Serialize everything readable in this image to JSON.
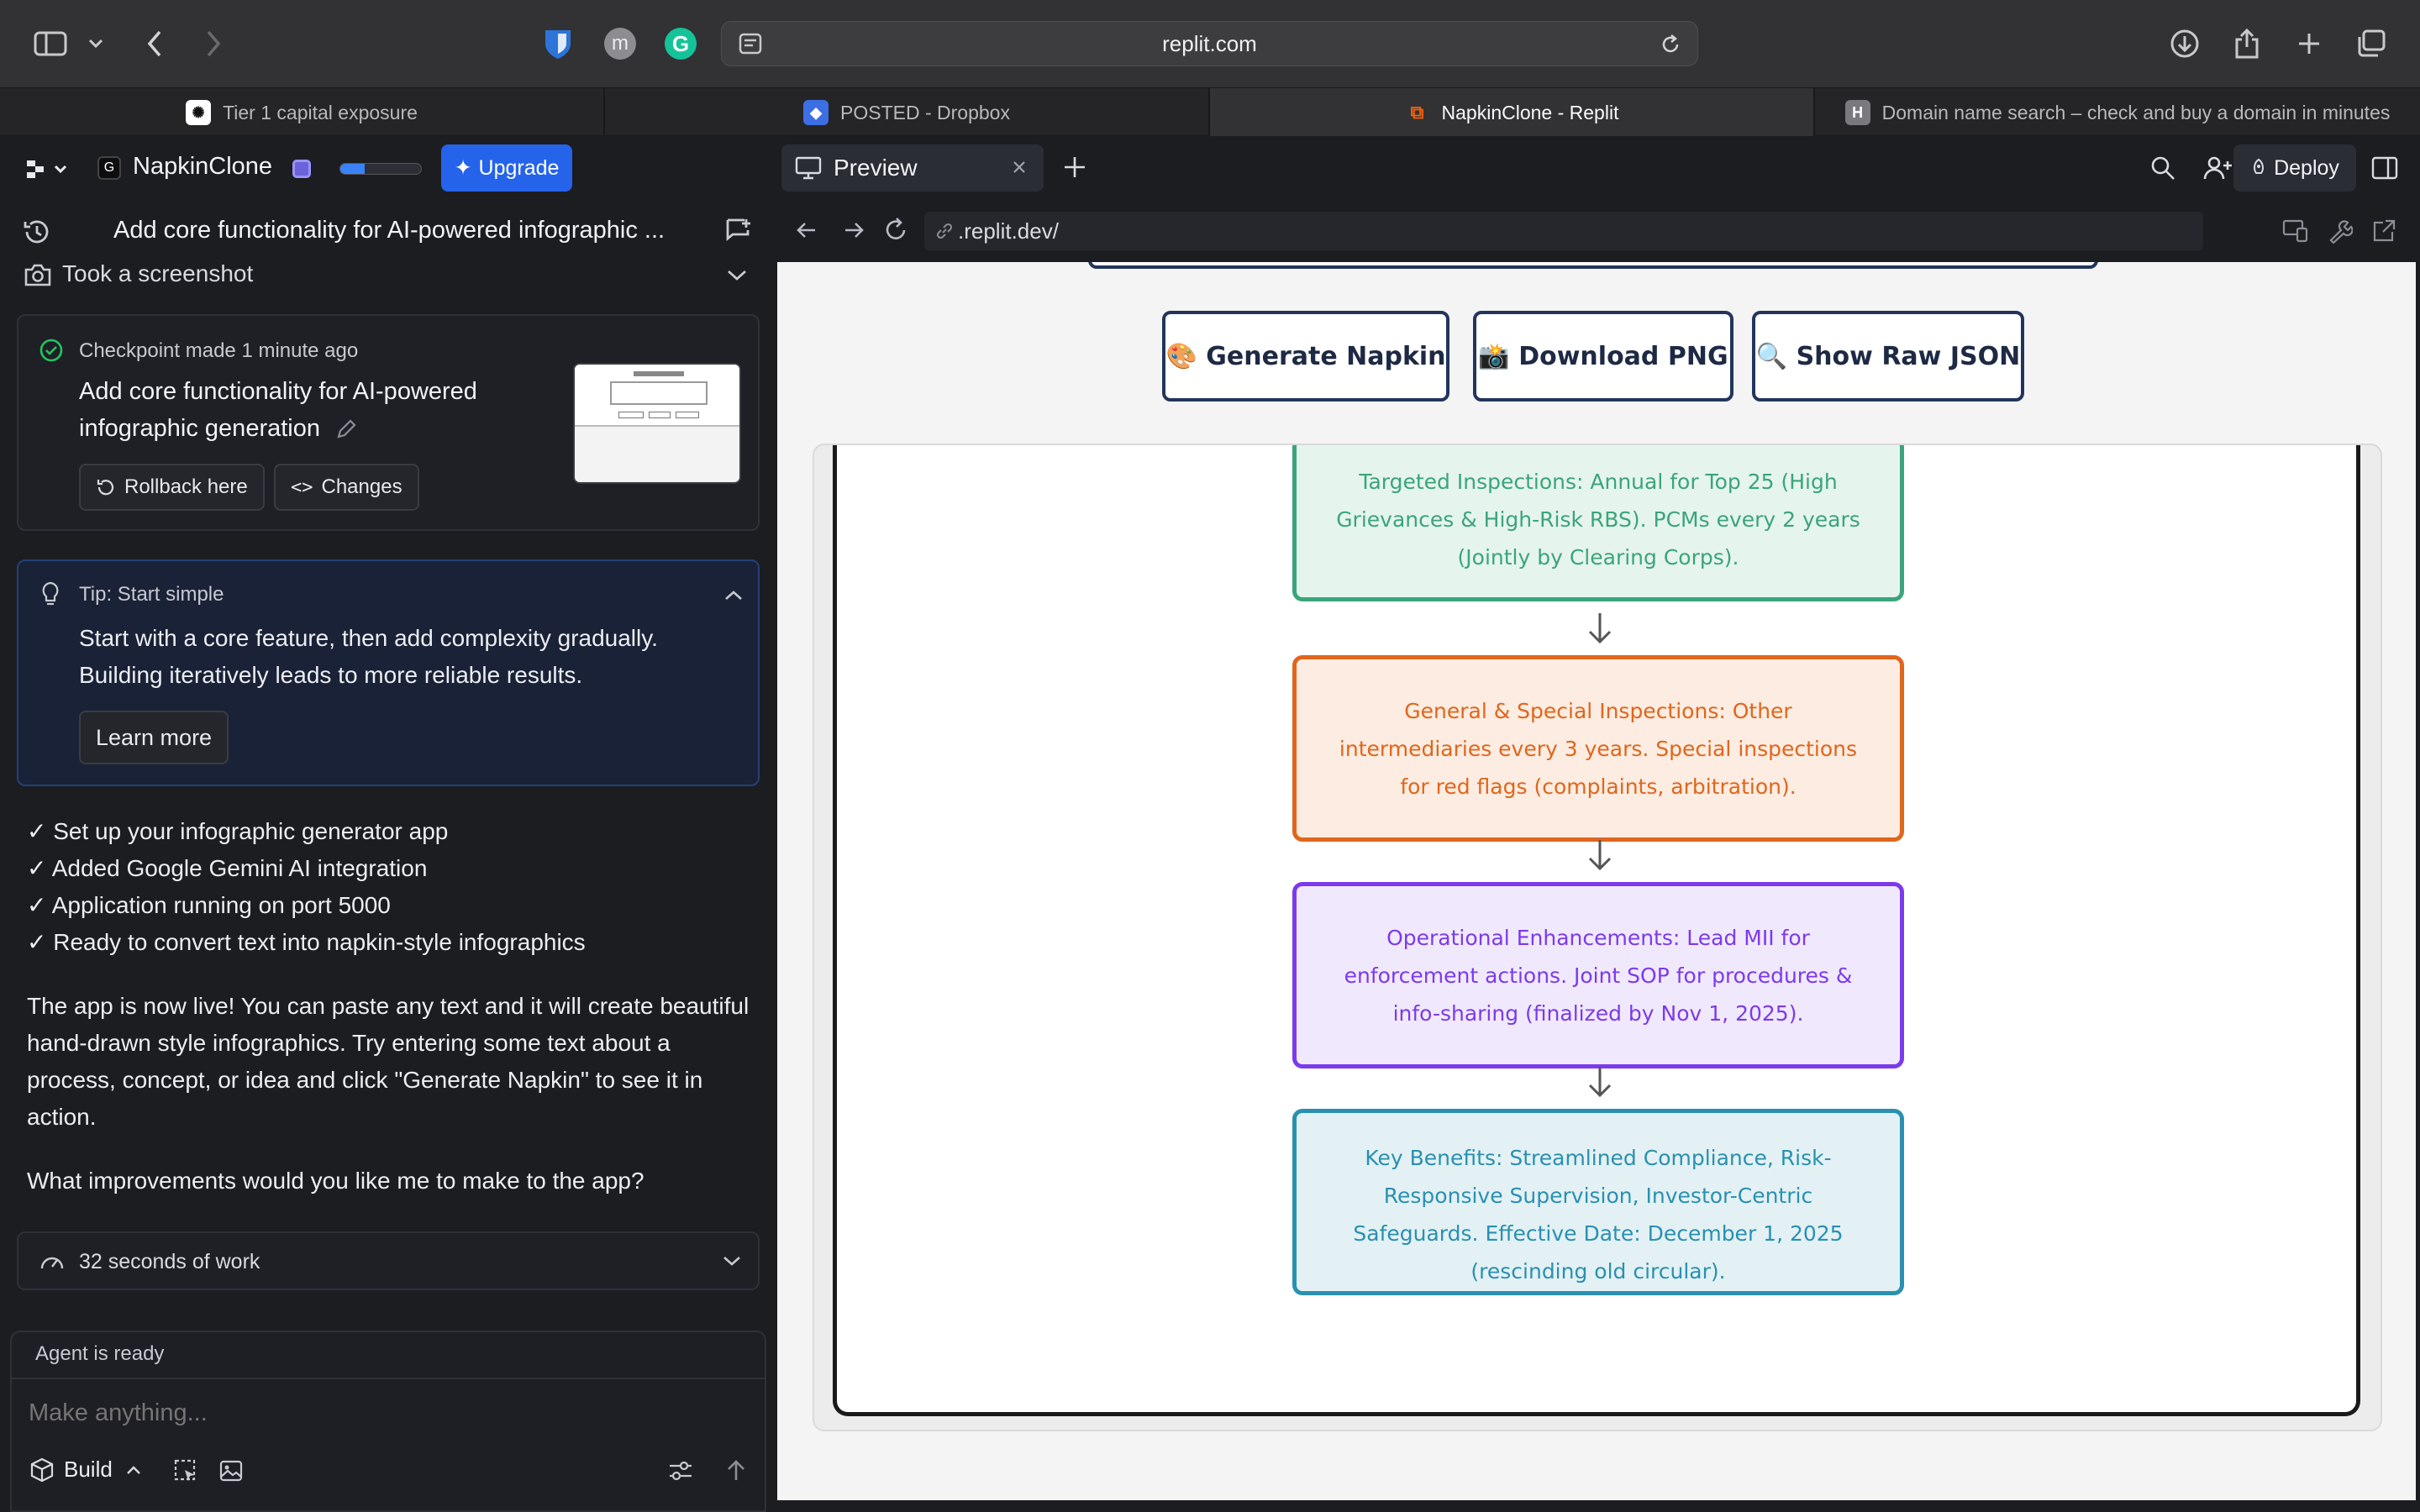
{
  "browser": {
    "url": "replit.com",
    "tabs": [
      {
        "label": "Tier 1 capital exposure",
        "active": false
      },
      {
        "label": "POSTED - Dropbox",
        "active": false
      },
      {
        "label": "NapkinClone - Replit",
        "active": true
      },
      {
        "label": "Domain name search – check and buy a domain in minutes",
        "active": false
      }
    ],
    "avatar_letter": "m"
  },
  "replit": {
    "project_name": "NapkinClone",
    "upgrade_label": "Upgrade",
    "progress": 0.3,
    "chat_title": "Add core functionality for AI-powered infographic ...",
    "screenshot_label": "Took a screenshot",
    "checkpoint": {
      "meta_prefix": "Checkpoint made",
      "time": "1 minute ago",
      "title": "Add core functionality for AI-powered infographic generation",
      "rollback_label": "Rollback here",
      "changes_label": "Changes"
    },
    "tip": {
      "title": "Tip: Start simple",
      "body": "Start with a core feature, then add complexity gradually. Building iteratively leads to more reliable results.",
      "learn_more": "Learn more"
    },
    "checklist": [
      "✓ Set up your infographic generator app",
      "✓ Added Google Gemini AI integration",
      "✓ Application running on port 5000",
      "✓ Ready to convert text into napkin-style infographics"
    ],
    "message": "The app is now live! You can paste any text and it will create beautiful hand-drawn style infographics. Try entering some text about a process, concept, or idea and click \"Generate Napkin\" to see it in action.",
    "question": "What improvements would you like me to make to the app?",
    "work_label": "32 seconds of work",
    "agent_status": "Agent is ready",
    "input_placeholder": "Make anything...",
    "build_label": "Build"
  },
  "workspace": {
    "tab_label": "Preview",
    "deploy_label": "Deploy",
    "preview_url": ".replit.dev/"
  },
  "app": {
    "buttons": {
      "generate": "🎨 Generate Napkin",
      "download": "📸 Download PNG",
      "raw_json": "🔍 Show Raw JSON"
    },
    "steps": [
      {
        "text": "Targeted Inspections: Annual for Top 25 (High Grievances & High-Risk RBS). PCMs every 2 years (Jointly by Clearing Corps).",
        "color": "#3aa57a",
        "bg": "#e6f4ee"
      },
      {
        "text": "General & Special Inspections: Other intermediaries every 3 years. Special inspections for red flags (complaints, arbitration).",
        "color": "#e0661c",
        "bg": "#fcece1"
      },
      {
        "text": "Operational Enhancements: Lead MII for enforcement actions. Joint SOP for procedures & info-sharing (finalized by Nov 1, 2025).",
        "color": "#7c3aed",
        "bg": "#f0e9fd"
      },
      {
        "text": "Key Benefits: Streamlined Compliance, Risk-Responsive Supervision, Investor-Centric Safeguards. Effective Date: December 1, 2025 (rescinding old circular).",
        "color": "#2a90b0",
        "bg": "#e3f1f4"
      }
    ]
  }
}
